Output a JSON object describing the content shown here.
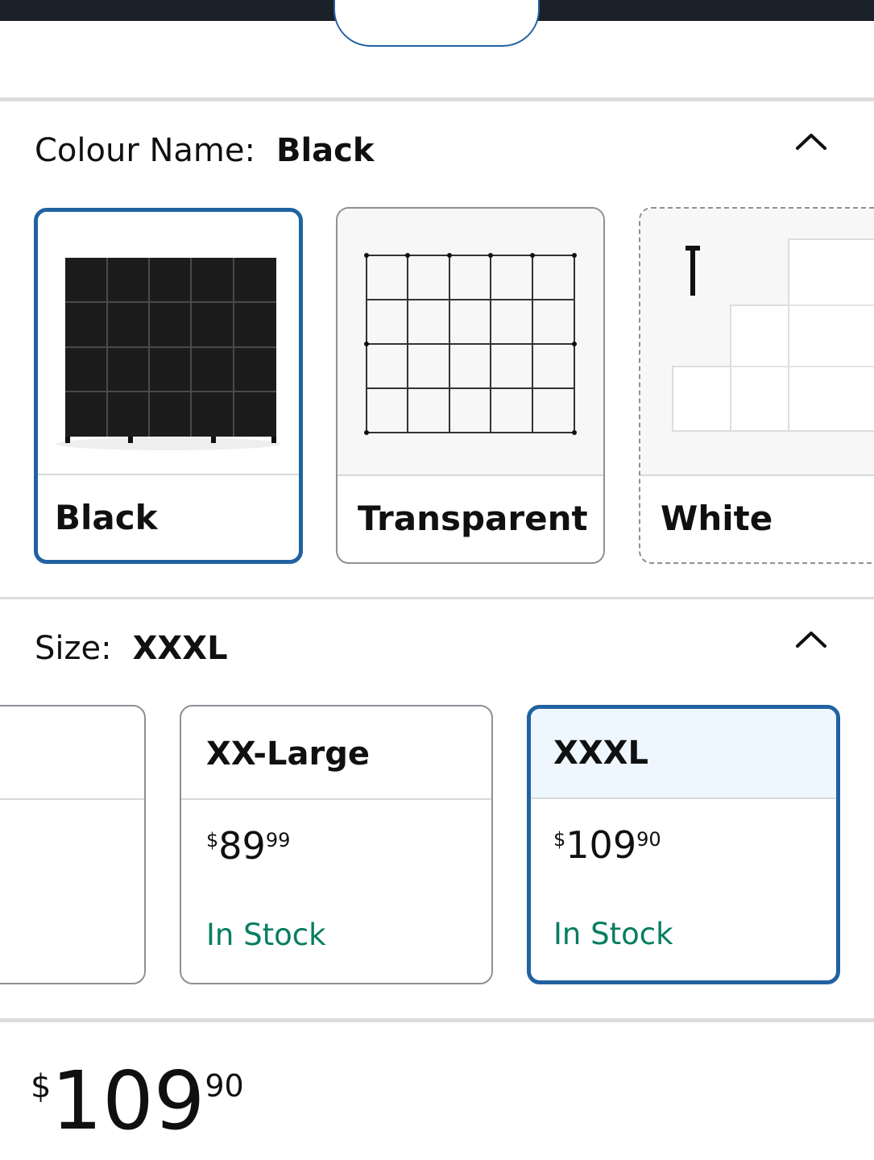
{
  "colour": {
    "label": "Colour Name:",
    "selected": "Black",
    "options": [
      {
        "name": "Black"
      },
      {
        "name": "Transparent"
      },
      {
        "name": "White"
      }
    ]
  },
  "size": {
    "label": "Size:",
    "selected": "XXXL",
    "options": [
      {
        "name": "XX-Large",
        "currency": "$",
        "whole": "89",
        "fraction": "99",
        "stock": "In Stock"
      },
      {
        "name": "XXXL",
        "currency": "$",
        "whole": "109",
        "fraction": "90",
        "stock": "In Stock"
      }
    ]
  },
  "price": {
    "currency": "$",
    "whole": "109",
    "fraction": "90"
  },
  "colors": {
    "accent": "#2162a1",
    "in_stock": "#067d62",
    "selected_bg": "#eef7fd"
  },
  "icons": {
    "collapse": "chevron-up-icon"
  }
}
